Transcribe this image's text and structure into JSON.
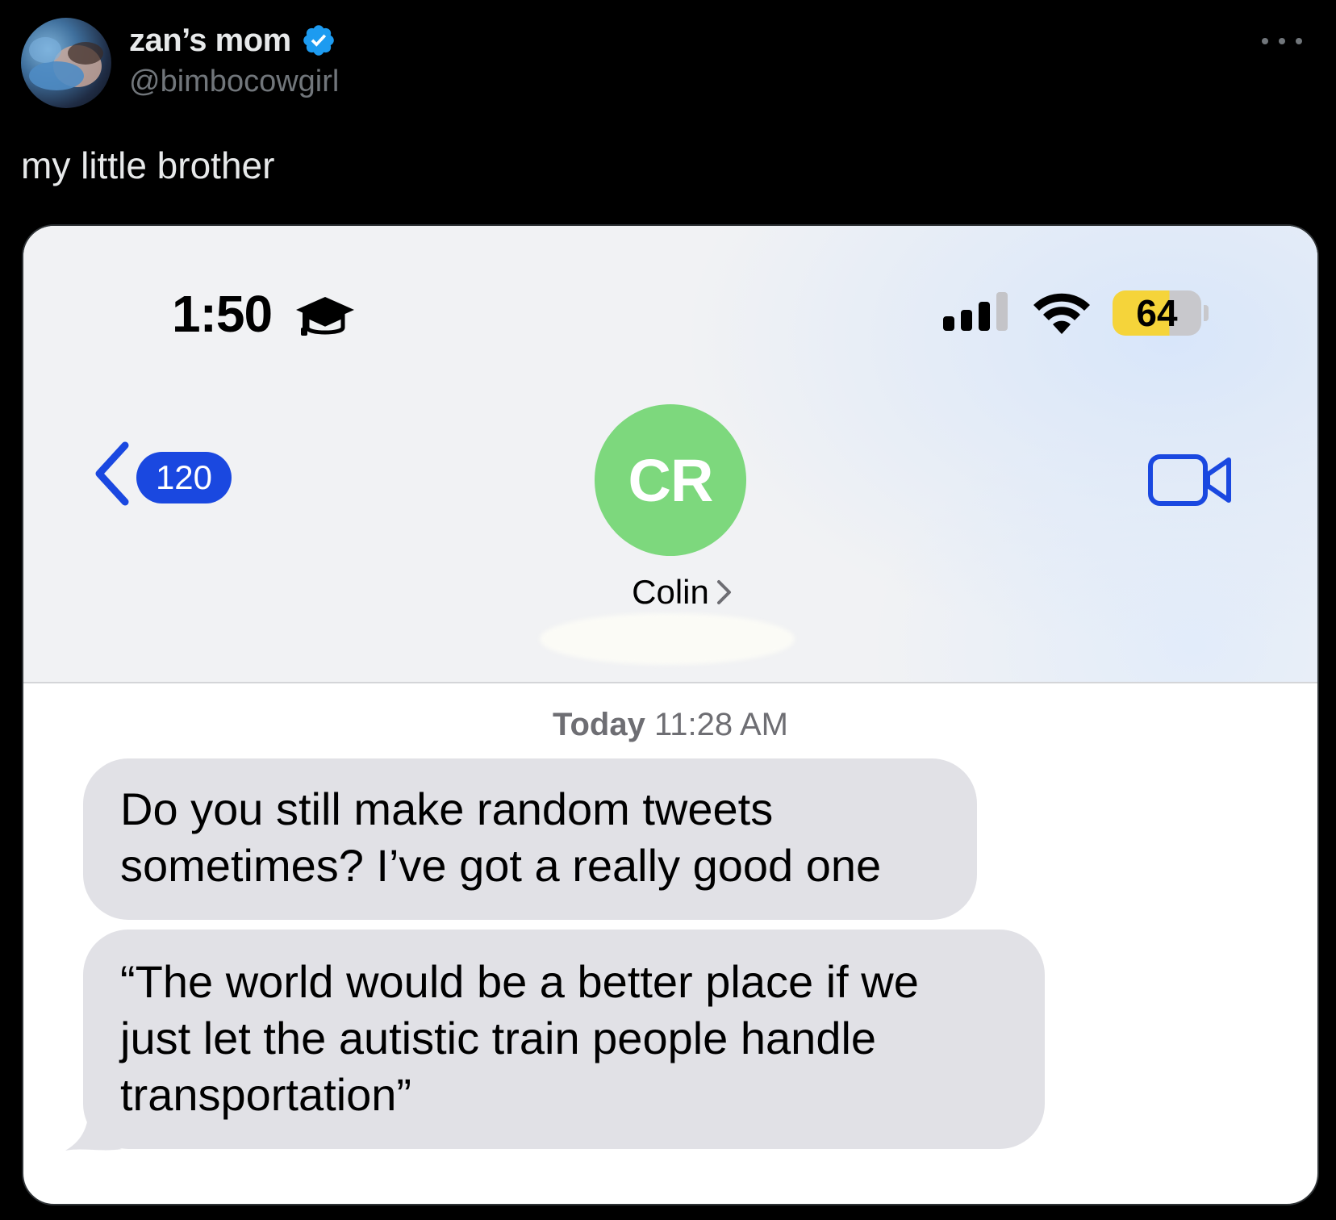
{
  "tweet": {
    "display_name": "zan’s mom",
    "handle": "@bimbocowgirl",
    "text": "my little brother"
  },
  "phone": {
    "status_bar": {
      "time": "1:50",
      "focus_icon": "graduation-cap-icon",
      "battery": "64"
    },
    "nav": {
      "back_count": "120",
      "contact_initials": "CR",
      "contact_name": "Colin"
    },
    "messages": {
      "timestamp_day": "Today",
      "timestamp_time": "11:28 AM",
      "items": [
        {
          "line1": "Do you still make random tweets",
          "line2": "sometimes? I’ve got a really good one"
        },
        {
          "line1": "“The world would be a better place if we",
          "line2": "just let the autistic train people handle",
          "line3": "transportation”"
        }
      ]
    }
  },
  "colors": {
    "background": "#000000",
    "verified": "#1d9bf0",
    "imessage_blue": "#1a48e0",
    "contact_avatar": "#7dd87d",
    "bubble_gray": "#e1e1e6",
    "battery_yellow": "#f5d43a"
  }
}
